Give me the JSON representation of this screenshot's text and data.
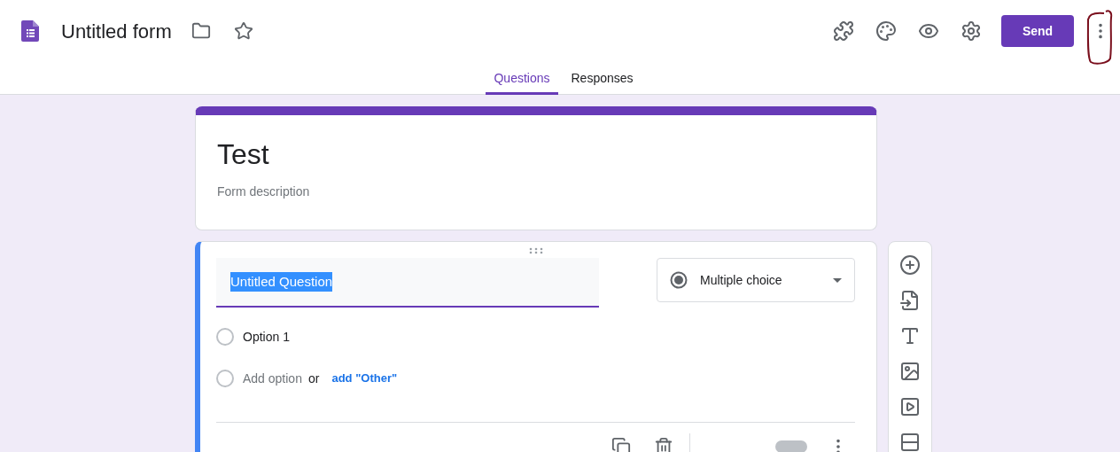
{
  "app": {
    "title": "Untitled form",
    "send_button": "Send"
  },
  "tabs": [
    {
      "label": "Questions",
      "selected": true
    },
    {
      "label": "Responses",
      "selected": false
    }
  ],
  "form": {
    "title": "Test",
    "description_placeholder": "Form description"
  },
  "question": {
    "title": "Untitled Question",
    "title_selected": true,
    "type": "Multiple choice",
    "options": [
      {
        "label": "Option 1",
        "selected": false
      }
    ],
    "required_on": false,
    "add_option": "Add option",
    "or": "or",
    "add_other": "add \"Other\""
  }
}
